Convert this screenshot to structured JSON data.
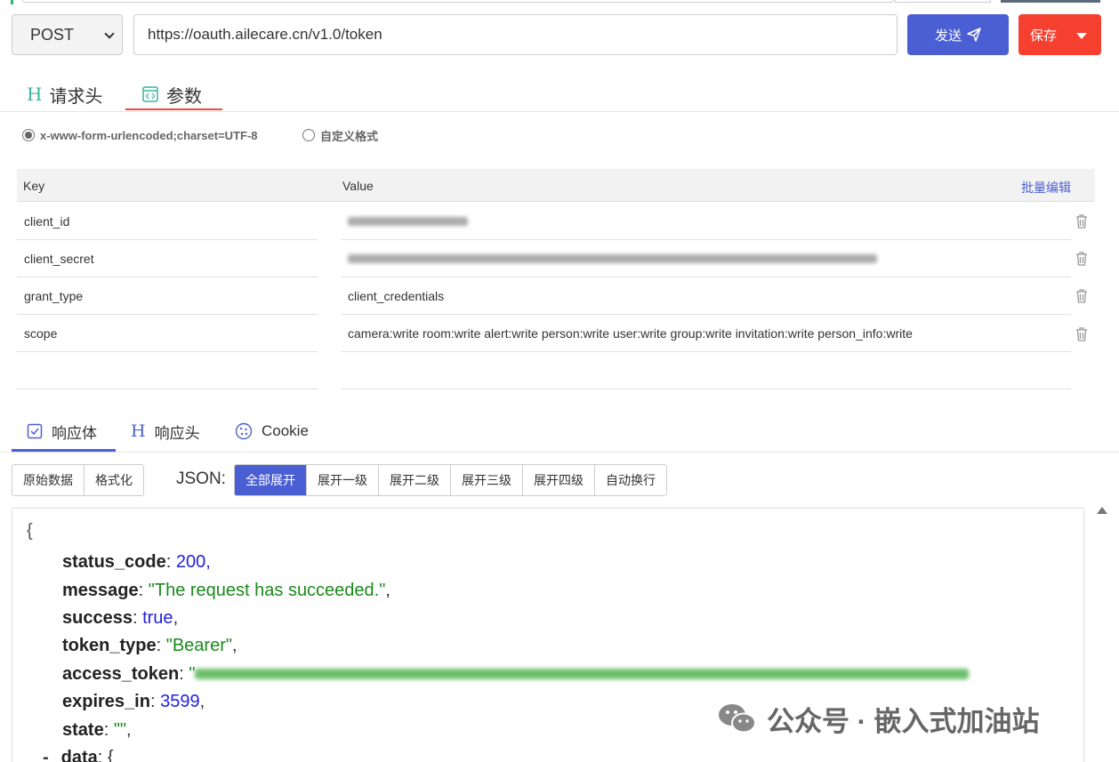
{
  "request": {
    "method": "POST",
    "url": "https://oauth.ailecare.cn/v1.0/token",
    "send_label": "发送",
    "save_label": "保存"
  },
  "request_tabs": [
    {
      "label": "请求头"
    },
    {
      "label": "参数",
      "active": true
    }
  ],
  "body_format": {
    "options": [
      "x-www-form-urlencoded;charset=UTF-8",
      "自定义格式"
    ],
    "selected": 0
  },
  "params_table": {
    "header": {
      "key": "Key",
      "value": "Value",
      "bulk_edit": "批量编辑"
    },
    "rows": [
      {
        "key": "client_id",
        "value": "",
        "value_redacted": true
      },
      {
        "key": "client_secret",
        "value": "",
        "value_redacted": true
      },
      {
        "key": "grant_type",
        "value": "client_credentials"
      },
      {
        "key": "scope",
        "value": "camera:write room:write alert:write person:write user:write group:write invitation:write person_info:write"
      }
    ]
  },
  "response_tabs": [
    {
      "label": "响应体",
      "active": true
    },
    {
      "label": "响应头"
    },
    {
      "label": "Cookie"
    }
  ],
  "view_buttons": {
    "raw": "原始数据",
    "format": "格式化",
    "json_label": "JSON:",
    "levels": [
      "全部展开",
      "展开一级",
      "展开二级",
      "展开三级",
      "展开四级",
      "自动换行"
    ],
    "active_level": 0
  },
  "response": {
    "open_brace": "{",
    "fields": [
      {
        "key": "status_code",
        "value": "200",
        "type": "number"
      },
      {
        "key": "message",
        "value": "\"The request has succeeded.\"",
        "type": "string"
      },
      {
        "key": "success",
        "value": "true",
        "type": "bool"
      },
      {
        "key": "token_type",
        "value": "\"Bearer\"",
        "type": "string"
      },
      {
        "key": "access_token",
        "value": "\"",
        "type": "string",
        "redacted": true
      },
      {
        "key": "expires_in",
        "value": "3599",
        "type": "number"
      },
      {
        "key": "state",
        "value": "\"\"",
        "type": "string"
      },
      {
        "key": "data",
        "value": "{",
        "type": "object"
      }
    ],
    "collapse_toggle": "-"
  },
  "watermark": "公众号 · 嵌入式加油站",
  "colors": {
    "primary": "#4a5fd4",
    "danger": "#f5402f",
    "json_string": "#1b8a1b",
    "json_number": "#2222dd",
    "tab_active_underline": "#e74c3c"
  }
}
